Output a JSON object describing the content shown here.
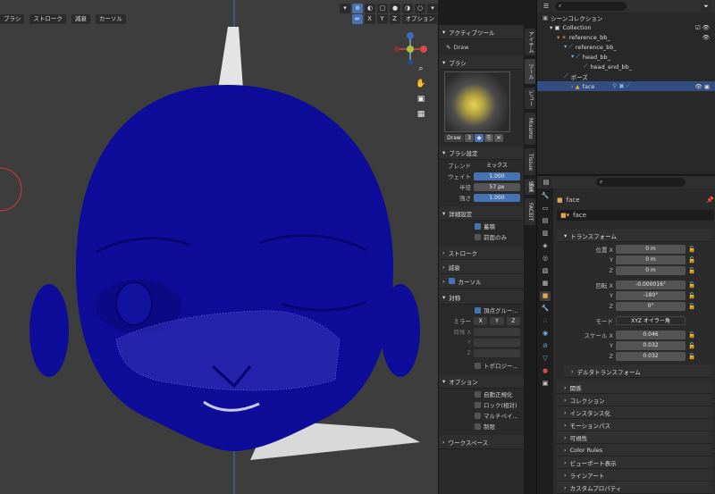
{
  "viewport": {
    "header_left": [
      "ブラシ",
      "ストローク",
      "減衰",
      "カーソル"
    ],
    "header_right_xyz": [
      "X",
      "Y",
      "Z"
    ],
    "header_right_option": "オプション"
  },
  "tool_panel": {
    "active_tool_title": "アクティブツール",
    "active_tool_name": "Draw",
    "brush_title": "ブラシ",
    "brush_name": "Draw",
    "brush_users": "3",
    "brush_settings_title": "ブラシ設定",
    "blend_label": "ブレンド",
    "blend_value": "ミックス",
    "weight_label": "ウェイト",
    "weight_value": "1.000",
    "radius_label": "半径",
    "radius_value": "57 px",
    "strength_label": "強さ",
    "strength_value": "1.000",
    "advanced_title": "詳細設定",
    "accumulate_label": "蓄積",
    "front_only_label": "前面のみ",
    "stroke_title": "ストローク",
    "falloff_title": "減衰",
    "cursor_title": "カーソル",
    "symmetry_title": "対称",
    "vertex_group_label": "頂点グルー...",
    "mirror_label": "ミラー",
    "mirror_axes": [
      "X",
      "Y",
      "Z"
    ],
    "lock_x_label": "特殊 X",
    "lock_y_label": "Y",
    "lock_z_label": "Z",
    "topology_label": "トポロジー...",
    "options_title": "オプション",
    "auto_smooth_label": "自動正規化",
    "lock_relative_label": "ロック(相対)",
    "multipaint_label": "マルチペイ...",
    "restrict_label": "制限",
    "workspace_title": "ワークスペース"
  },
  "side_tabs": [
    "アイテム",
    "ツール",
    "ビュー",
    "Mixamo",
    "Tissue",
    "編集",
    "FACEIT"
  ],
  "outliner": {
    "rows": [
      {
        "label": "シーンコレクション",
        "indent": 0
      },
      {
        "label": "Collection",
        "indent": 1
      },
      {
        "label": "reference_bb_",
        "indent": 2
      },
      {
        "label": "reference_bb_",
        "indent": 3
      },
      {
        "label": "head_bb_",
        "indent": 4
      },
      {
        "label": "head_end_bb_",
        "indent": 5
      },
      {
        "label": "ポーズ",
        "indent": 3
      },
      {
        "label": "face",
        "indent": 2
      }
    ]
  },
  "properties": {
    "object_name": "face",
    "object_data_name": "face",
    "transform_title": "トランスフォーム",
    "location_label": "位置 X",
    "location": [
      "0 m",
      "0 m",
      "0 m"
    ],
    "rotation_label": "回転 X",
    "rotation": [
      "-0.000016°",
      "-180°",
      "0°"
    ],
    "mode_label": "モード",
    "mode_value": "XYZ オイラー角",
    "scale_label": "スケール X",
    "scale": [
      "0.046",
      "0.032",
      "0.032"
    ],
    "axis_y": "Y",
    "axis_z": "Z",
    "delta_title": "デルタトランスフォーム",
    "sections": [
      "関係",
      "コレクション",
      "インスタンス化",
      "モーションパス",
      "可視性",
      "Color Rules",
      "ビューポート表示",
      "ラインアート",
      "カスタムプロパティ"
    ]
  },
  "colors": {
    "mesh": "#0d0d9a",
    "accent": "#4772b3",
    "selected_row": "#334d80"
  }
}
